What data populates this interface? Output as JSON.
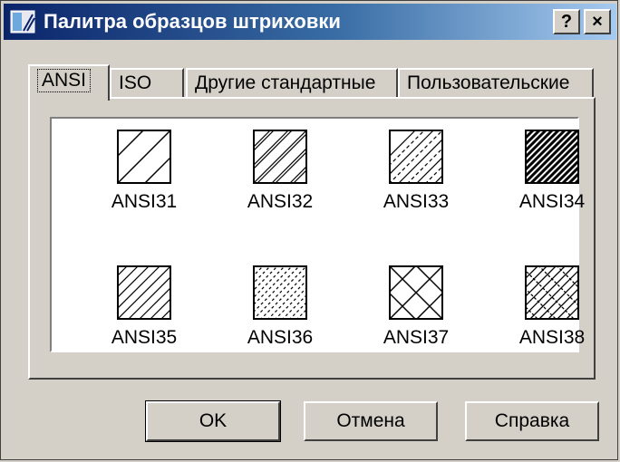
{
  "window": {
    "title": "Палитра образцов штриховки",
    "help_button": "?",
    "close_button": "×"
  },
  "tabs": [
    {
      "label": "ANSI",
      "active": true
    },
    {
      "label": "ISO",
      "active": false
    },
    {
      "label": "Другие стандартные",
      "active": false
    },
    {
      "label": "Пользовательские",
      "active": false
    }
  ],
  "patterns": [
    {
      "name": "ANSI31",
      "pattern": "wide-diagonal"
    },
    {
      "name": "ANSI32",
      "pattern": "paired-diagonal"
    },
    {
      "name": "ANSI33",
      "pattern": "line-dash-diagonal"
    },
    {
      "name": "ANSI34",
      "pattern": "dense-diagonal"
    },
    {
      "name": "ANSI35",
      "pattern": "fine-diagonal"
    },
    {
      "name": "ANSI36",
      "pattern": "dotted-diagonal"
    },
    {
      "name": "ANSI37",
      "pattern": "crosshatch"
    },
    {
      "name": "ANSI38",
      "pattern": "dense-crosshatch"
    }
  ],
  "buttons": {
    "ok": "OK",
    "cancel": "Отмена",
    "help": "Справка"
  }
}
